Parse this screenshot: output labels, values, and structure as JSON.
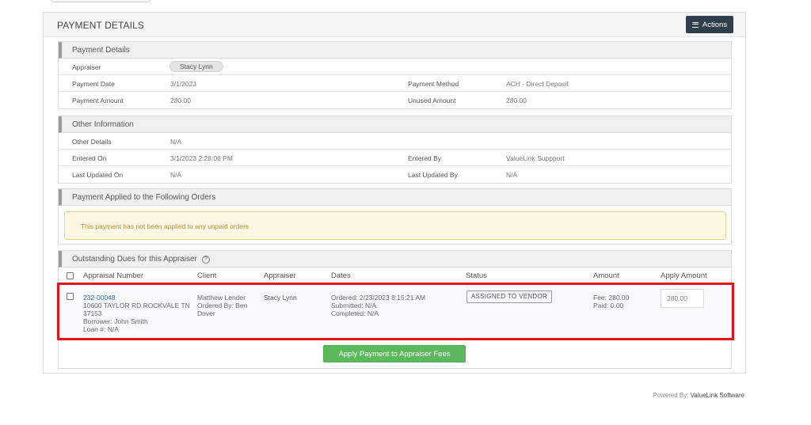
{
  "panel": {
    "title": "PAYMENT DETAILS",
    "actions_label": "Actions"
  },
  "payment_details": {
    "heading": "Payment Details",
    "appraiser_label": "Appraiser",
    "appraiser_value": "Stacy Lynn",
    "payment_date_label": "Payment Date",
    "payment_date_value": "3/1/2023",
    "payment_method_label": "Payment Method",
    "payment_method_value": "ACH - Direct Deposit",
    "payment_amount_label": "Payment Amount",
    "payment_amount_value": "280.00",
    "unused_amount_label": "Unused Amount",
    "unused_amount_value": "280.00"
  },
  "other_information": {
    "heading": "Other Information",
    "other_details_label": "Other Details",
    "other_details_value": "N/A",
    "entered_on_label": "Entered On",
    "entered_on_value": "3/1/2023 2:28:06 PM",
    "entered_by_label": "Entered By",
    "entered_by_value": "ValueLink Suppport",
    "last_updated_on_label": "Last Updated On",
    "last_updated_on_value": "N/A",
    "last_updated_by_label": "Last Updated By",
    "last_updated_by_value": "N/A"
  },
  "applied_orders": {
    "heading": "Payment Applied to the Following Orders",
    "notice": "This payment has not been applied to any unpaid orders"
  },
  "outstanding_dues": {
    "heading": "Outstanding Dues for this Appraiser",
    "help_icon": "?",
    "columns": {
      "appraisal_number": "Appraisal Number",
      "client": "Client",
      "appraiser": "Appraiser",
      "dates": "Dates",
      "status": "Status",
      "amount": "Amount",
      "apply_amount": "Apply Amount"
    },
    "row": {
      "appraisal_number": "232-00048",
      "address_line1": "10600 TAYLOR RD ROCKVALE TN",
      "address_line2": "37153",
      "borrower": "Borrower: John Smith",
      "loan": "Loan #: N/A",
      "client_line1": "Matthew Lender",
      "client_line2": "Ordered By: Ben",
      "client_line3": "Dover",
      "appraiser": "Stacy Lynn",
      "ordered": "Ordered: 2/23/2023 8:15:21 AM",
      "submitted": "Submitted: N/A",
      "completed": "Completed: N/A",
      "status": "ASSIGNED TO VENDOR",
      "fee": "Fee: 280.00",
      "paid": "Paid: 0.00",
      "apply_amount": "280.00"
    },
    "apply_button_label": "Apply Payment to Appraiser Fees"
  },
  "footer": {
    "powered_by": "Powered By:",
    "brand": "ValueLink Software"
  },
  "colors": {
    "actions_button": "#2f3e4d",
    "apply_button": "#5cb85c",
    "highlight_border": "#e3131b",
    "notice_background": "#fcf8e3",
    "link": "#2a6eb1"
  }
}
